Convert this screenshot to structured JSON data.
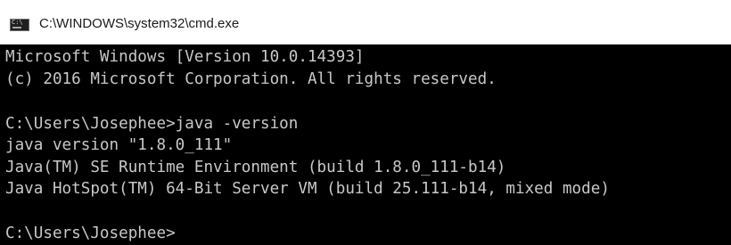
{
  "window": {
    "title": "C:\\WINDOWS\\system32\\cmd.exe",
    "icon": "cmd-console-icon"
  },
  "console": {
    "lines": [
      "Microsoft Windows [Version 10.0.14393]",
      "(c) 2016 Microsoft Corporation. All rights reserved.",
      "",
      "C:\\Users\\Josephee>java -version",
      "java version \"1.8.0_111\"",
      "Java(TM) SE Runtime Environment (build 1.8.0_111-b14)",
      "Java HotSpot(TM) 64-Bit Server VM (build 25.111-b14, mixed mode)",
      "",
      "C:\\Users\\Josephee>"
    ]
  },
  "colors": {
    "background": "#000000",
    "text": "#c8c8c8",
    "titlebar": "#ffffff"
  }
}
